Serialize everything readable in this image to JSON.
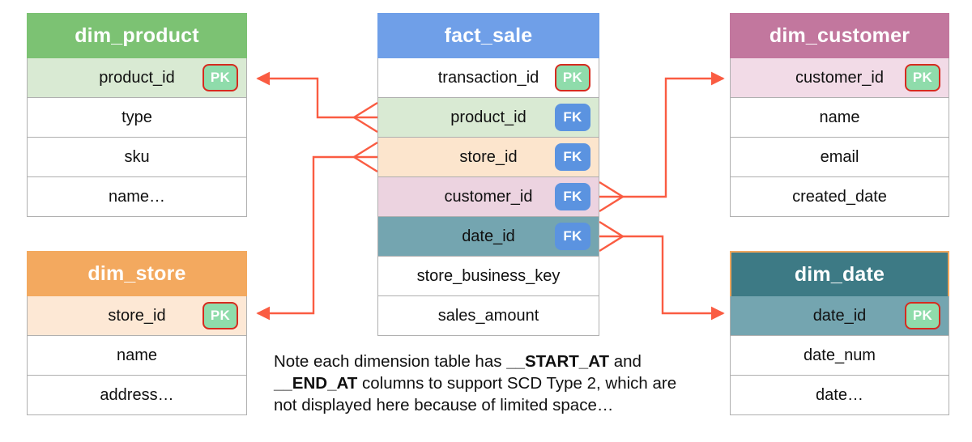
{
  "diagram": {
    "type": "star-schema-erd",
    "accent_color": "#fa5c42",
    "note": {
      "prefix": "Note each dimension table has ",
      "bold1": "__START_AT",
      "middle": " and ",
      "bold2": "__END_AT",
      "suffix": " columns to support SCD Type 2, which are not displayed here because of limited space…"
    }
  },
  "tables": {
    "fact_sale": {
      "name": "fact_sale",
      "header_color": "#6f9fe8",
      "columns": [
        {
          "name": "transaction_id",
          "key": "PK",
          "row_color": "#ffffff"
        },
        {
          "name": "product_id",
          "key": "FK",
          "row_color": "#d9ead3"
        },
        {
          "name": "store_id",
          "key": "FK",
          "row_color": "#fce5cd"
        },
        {
          "name": "customer_id",
          "key": "FK",
          "row_color": "#ecd3e0"
        },
        {
          "name": "date_id",
          "key": "FK",
          "row_color": "#74a5b0"
        },
        {
          "name": "store_business_key",
          "key": "",
          "row_color": "#ffffff"
        },
        {
          "name": "sales_amount",
          "key": "",
          "row_color": "#ffffff"
        }
      ]
    },
    "dim_product": {
      "name": "dim_product",
      "header_color": "#7cc273",
      "columns": [
        {
          "name": "product_id",
          "key": "PK",
          "row_color": "#d9ead3"
        },
        {
          "name": "type",
          "key": "",
          "row_color": "#ffffff"
        },
        {
          "name": "sku",
          "key": "",
          "row_color": "#ffffff"
        },
        {
          "name": "name…",
          "key": "",
          "row_color": "#ffffff"
        }
      ]
    },
    "dim_store": {
      "name": "dim_store",
      "header_color": "#f3a95f",
      "columns": [
        {
          "name": "store_id",
          "key": "PK",
          "row_color": "#fde8d5"
        },
        {
          "name": "name",
          "key": "",
          "row_color": "#ffffff"
        },
        {
          "name": "address…",
          "key": "",
          "row_color": "#ffffff"
        }
      ]
    },
    "dim_customer": {
      "name": "dim_customer",
      "header_color": "#c2779e",
      "columns": [
        {
          "name": "customer_id",
          "key": "PK",
          "row_color": "#f2dbe7"
        },
        {
          "name": "name",
          "key": "",
          "row_color": "#ffffff"
        },
        {
          "name": "email",
          "key": "",
          "row_color": "#ffffff"
        },
        {
          "name": "created_date",
          "key": "",
          "row_color": "#ffffff"
        }
      ]
    },
    "dim_date": {
      "name": "dim_date",
      "header_color": "#3d7a85",
      "columns": [
        {
          "name": "date_id",
          "key": "PK",
          "row_color": "#74a5b0"
        },
        {
          "name": "date_num",
          "key": "",
          "row_color": "#ffffff"
        },
        {
          "name": "date…",
          "key": "",
          "row_color": "#ffffff"
        }
      ]
    }
  },
  "relationships": [
    {
      "from": "fact_sale.product_id",
      "to": "dim_product.product_id",
      "cardinality": "many-to-one"
    },
    {
      "from": "fact_sale.store_id",
      "to": "dim_store.store_id",
      "cardinality": "many-to-one"
    },
    {
      "from": "fact_sale.customer_id",
      "to": "dim_customer.customer_id",
      "cardinality": "many-to-one"
    },
    {
      "from": "fact_sale.date_id",
      "to": "dim_date.date_id",
      "cardinality": "many-to-one"
    }
  ]
}
